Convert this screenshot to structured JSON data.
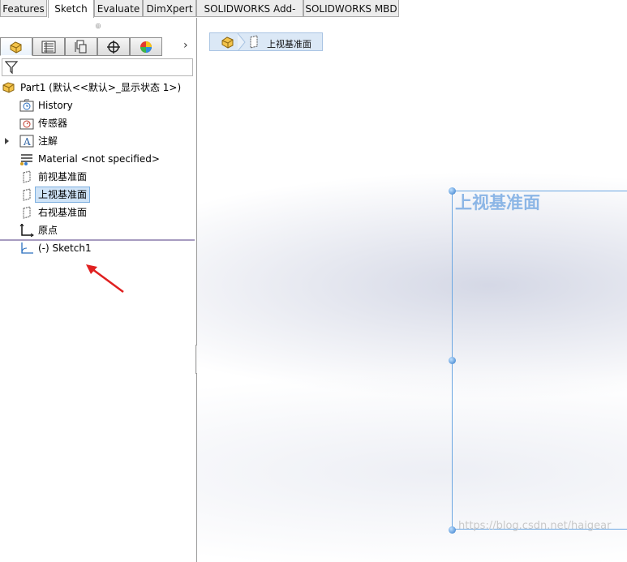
{
  "command_tabs": [
    {
      "label": "Features",
      "active": false
    },
    {
      "label": "Sketch",
      "active": true
    },
    {
      "label": "Evaluate",
      "active": false
    },
    {
      "label": "DimXpert",
      "active": false
    },
    {
      "label": "SOLIDWORKS Add-Ins",
      "active": false
    },
    {
      "label": "SOLIDWORKS MBD",
      "active": false
    }
  ],
  "panel_tabs": [
    {
      "icon": "feature-manager-icon"
    },
    {
      "icon": "property-manager-icon"
    },
    {
      "icon": "configuration-manager-icon"
    },
    {
      "icon": "dimxpert-manager-icon"
    },
    {
      "icon": "display-manager-icon"
    }
  ],
  "panel_next": "›",
  "tree": {
    "part": "Part1  (默认<<默认>_显示状态 1>)",
    "history": "History",
    "sensors": "传感器",
    "annotations": "注解",
    "material": "Material <not specified>",
    "front_plane": "前视基准面",
    "top_plane": "上视基准面",
    "right_plane": "右视基准面",
    "origin": "原点",
    "sketch": "(-) Sketch1"
  },
  "breadcrumb": {
    "label": "上视基准面"
  },
  "graphics": {
    "plane_label": "上视基准面",
    "watermark": "https://blog.csdn.net/haigear"
  },
  "colors": {
    "selection": "#cfe3f7",
    "plane_border": "#6ca7e2",
    "annotation_arrow": "#e02020"
  }
}
